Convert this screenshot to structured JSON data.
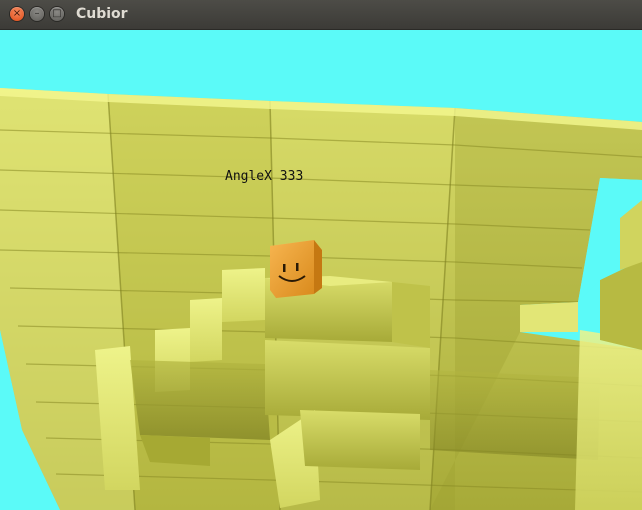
{
  "window": {
    "title": "Cubior",
    "buttons": {
      "close_icon": "close-icon",
      "minimize_icon": "minimize-icon",
      "maximize_icon": "maximize-icon"
    }
  },
  "game": {
    "hud_text": "AngleX 333",
    "colors": {
      "sky": "#5bfaf8",
      "block_light": "#f2f78e",
      "block_mid": "#c8cc55",
      "block_dark": "#8f9129",
      "player_face": "#f0a33a"
    }
  }
}
